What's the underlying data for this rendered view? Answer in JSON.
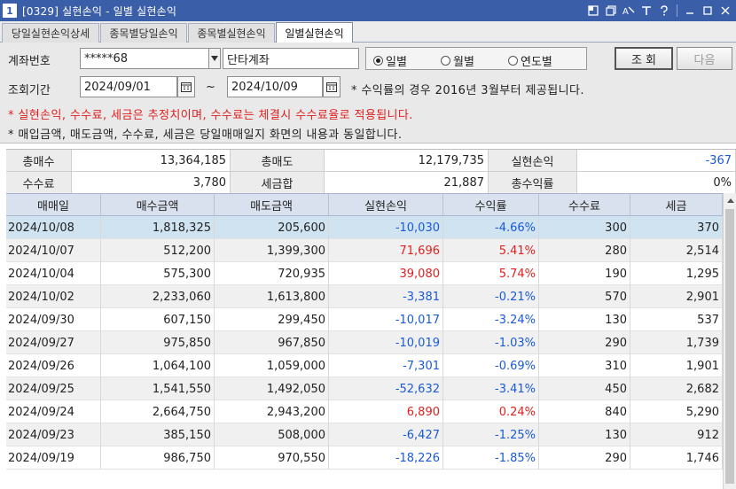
{
  "window": {
    "number": "1",
    "title": "[0329] 실현손익 - 일별 실현손익"
  },
  "tabs": [
    {
      "label": "당일실현손익상세"
    },
    {
      "label": "종목별당일손익"
    },
    {
      "label": "종목별실현손익"
    },
    {
      "label": "일별실현손익"
    }
  ],
  "filters": {
    "account_label": "계좌번호",
    "account_value": "*****68",
    "account_name": "단타계좌",
    "period_label": "조회기간",
    "date_from": "2024/09/01",
    "date_sep": "~",
    "date_to": "2024/10/09",
    "radio_daily": "일별",
    "radio_monthly": "월별",
    "radio_yearly": "연도별",
    "query_button": "조 회",
    "next_button": "다음",
    "note_period": "* 수익률의 경우 2016년 3월부터 제공됩니다.",
    "note_estimate": "* 실현손익, 수수료, 세금은 추정치이며, 수수료는 체결시 수수료율로 적용됩니다.",
    "note_same": "* 매입금액, 매도금액, 수수료, 세금은 당일매매일지 화면의 내용과 동일합니다."
  },
  "summary": {
    "total_buy_label": "총매수",
    "total_buy_value": "13,364,185",
    "total_sell_label": "총매도",
    "total_sell_value": "12,179,735",
    "realized_label": "실현손익",
    "realized_value": "-367",
    "fee_label": "수수료",
    "fee_value": "3,780",
    "tax_label": "세금합",
    "tax_value": "21,887",
    "return_label": "총수익률",
    "return_value": "0%"
  },
  "table": {
    "headers": [
      "매매일",
      "매수금액",
      "매도금액",
      "실현손익",
      "수익률",
      "수수료",
      "세금"
    ],
    "rows": [
      [
        "2024/10/08",
        "1,818,325",
        "205,600",
        "-10,030",
        "-4.66%",
        "300",
        "370"
      ],
      [
        "2024/10/07",
        "512,200",
        "1,399,300",
        "71,696",
        "5.41%",
        "280",
        "2,514"
      ],
      [
        "2024/10/04",
        "575,300",
        "720,935",
        "39,080",
        "5.74%",
        "190",
        "1,295"
      ],
      [
        "2024/10/02",
        "2,233,060",
        "1,613,800",
        "-3,381",
        "-0.21%",
        "570",
        "2,901"
      ],
      [
        "2024/09/30",
        "607,150",
        "299,450",
        "-10,017",
        "-3.24%",
        "130",
        "537"
      ],
      [
        "2024/09/27",
        "975,850",
        "967,850",
        "-10,019",
        "-1.03%",
        "290",
        "1,739"
      ],
      [
        "2024/09/26",
        "1,064,100",
        "1,059,000",
        "-7,301",
        "-0.69%",
        "310",
        "1,901"
      ],
      [
        "2024/09/25",
        "1,541,550",
        "1,492,050",
        "-52,632",
        "-3.41%",
        "450",
        "2,682"
      ],
      [
        "2024/09/24",
        "2,664,750",
        "2,943,200",
        "6,890",
        "0.24%",
        "840",
        "5,290"
      ],
      [
        "2024/09/23",
        "385,150",
        "508,000",
        "-6,427",
        "-1.25%",
        "130",
        "912"
      ],
      [
        "2024/09/19",
        "986,750",
        "970,550",
        "-18,226",
        "-1.85%",
        "290",
        "1,746"
      ]
    ]
  },
  "colors": {
    "title_bar": "#3b5ea8",
    "gain": "#e02020",
    "loss": "#1a5ad6",
    "selected_row": "#cfe3f1",
    "header_bg": "#d9e1ef"
  }
}
